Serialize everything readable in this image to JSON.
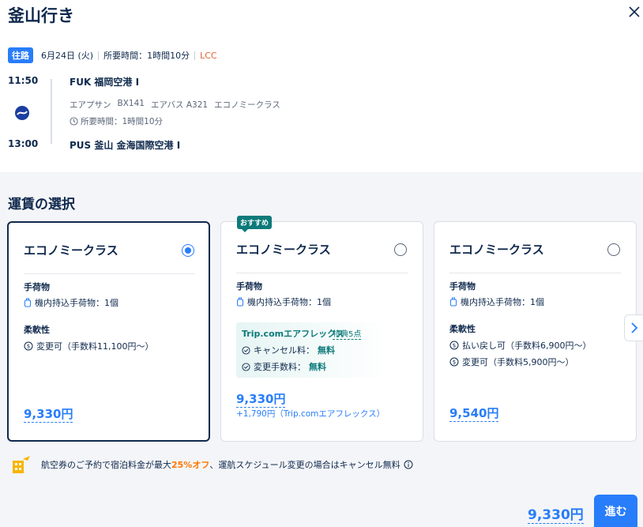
{
  "header": {
    "title": "釜山行き"
  },
  "flight": {
    "direction_badge": "往路",
    "date": "6月24日 (火)",
    "total_duration": "所要時間：1時間10分",
    "fare_type": "LCC",
    "departure_time": "11:50",
    "departure_airport": "FUK 福岡空港 I",
    "airline": "エアプサン",
    "flight_number": "BX141",
    "aircraft": "エアバス A321",
    "cabin": "エコノミークラス",
    "duration": "所要時間：1時間10分",
    "arrival_time": "13:00",
    "arrival_airport": "PUS 釜山 金海国際空港 I"
  },
  "fares": {
    "section_title": "運賃の選択",
    "recommended_badge": "おすすめ",
    "cards": [
      {
        "title": "エコノミークラス",
        "baggage_heading": "手荷物",
        "baggage": "機内持込手荷物：1個",
        "flex_heading": "柔軟性",
        "flex_items": [
          "変更可（手数料11,100円～）"
        ],
        "price": "9,330円",
        "selected": true
      },
      {
        "title": "エコノミークラス",
        "baggage_heading": "手荷物",
        "baggage": "機内持込手荷物：1個",
        "flex_product": "Trip.comエアフレックス",
        "flex_benefit": "特典5点",
        "flex_cancel_label": "キャンセル料：",
        "flex_cancel_value": "無料",
        "flex_change_label": "変更手数料：",
        "flex_change_value": "無料",
        "price": "9,330円",
        "extra": "+1,790円（Trip.comエアフレックス）",
        "selected": false
      },
      {
        "title": "エコノミークラス",
        "baggage_heading": "手荷物",
        "baggage": "機内持込手荷物：1個",
        "flex_heading": "柔軟性",
        "flex_items": [
          "払い戻し可（手数料6,900円～）",
          "変更可（手数料5,900円～）"
        ],
        "price": "9,540円",
        "selected": false
      }
    ]
  },
  "notice": {
    "prefix": "航空券のご予約で宿泊料金が最大",
    "highlight": "25%オフ",
    "suffix": "、運航スケジュール変更の場合はキャンセル無料"
  },
  "footer": {
    "total_price": "9,330円",
    "proceed_label": "進む"
  },
  "colors": {
    "accent": "#287dfa",
    "navy": "#0f294d",
    "teal": "#0d7a7a",
    "lcc": "#e0632f",
    "highlight": "#ff7700"
  }
}
